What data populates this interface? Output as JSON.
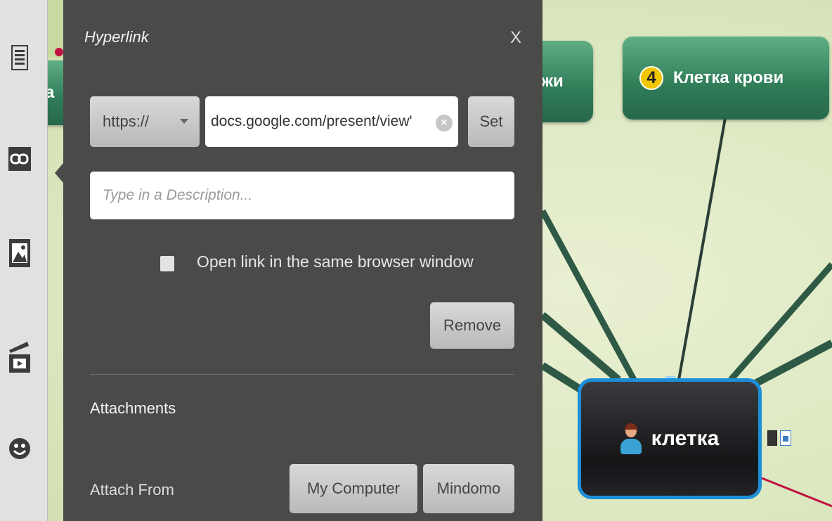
{
  "panel": {
    "title": "Hyperlink",
    "close_label": "X",
    "protocol_value": "https://",
    "url_value": "docs.google.com/present/view'",
    "clear_glyph": "×",
    "set_label": "Set",
    "description_placeholder": "Type in a Description...",
    "checkbox_label": "Open link in the same browser window",
    "checkbox_checked": false,
    "remove_label": "Remove",
    "attachments_title": "Attachments",
    "attach_from_label": "Attach From",
    "my_computer_label": "My Computer",
    "mindomo_label": "Mindomo"
  },
  "sidebar": {
    "items": [
      {
        "name": "notes",
        "icon": "notes-icon"
      },
      {
        "name": "hyperlink",
        "icon": "link-icon",
        "active": true
      },
      {
        "name": "image",
        "icon": "image-icon"
      },
      {
        "name": "media",
        "icon": "video-icon"
      },
      {
        "name": "emoji",
        "icon": "smiley-icon"
      }
    ]
  },
  "mindmap": {
    "left_topic_partial": "а",
    "topic_partial": "жи",
    "topic_blood": {
      "number": "4",
      "label": "Клетка крови"
    },
    "central_topic": "клетка"
  },
  "colors": {
    "panel_bg": "#4a4a49",
    "topic_green": "#2f7c57",
    "central_border": "#1d8ed8",
    "canvas_bg": "#dfe9c4"
  }
}
